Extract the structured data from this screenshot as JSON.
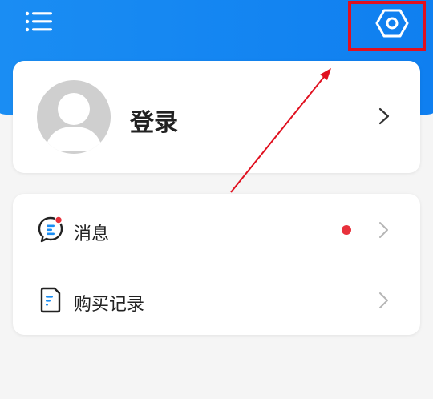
{
  "header": {
    "menu_icon": "hamburger-menu-icon",
    "settings_icon": "settings-hexagon-icon",
    "accent_color": "#1a8df3"
  },
  "login": {
    "label": "登录",
    "avatar_icon": "default-avatar-icon"
  },
  "menu": {
    "items": [
      {
        "label": "消息",
        "icon": "message-icon",
        "has_unread_dot": true
      },
      {
        "label": "购买记录",
        "icon": "purchase-record-icon",
        "has_unread_dot": false
      }
    ]
  },
  "annotation": {
    "highlight_color": "#e0101f"
  }
}
